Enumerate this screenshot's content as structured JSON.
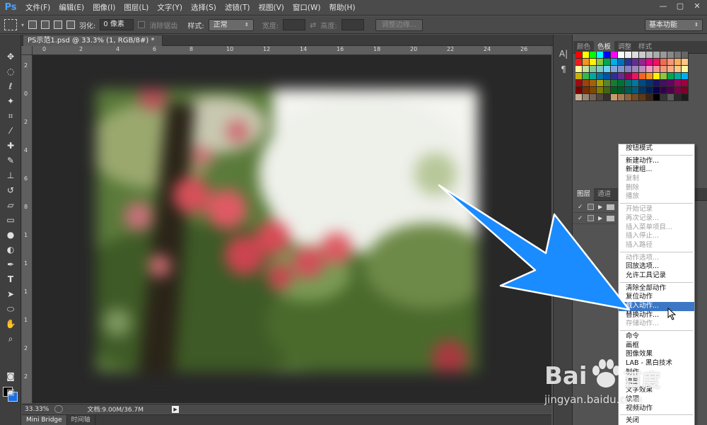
{
  "app": {
    "logo": "Ps"
  },
  "menubar": {
    "items": [
      "文件(F)",
      "编辑(E)",
      "图像(I)",
      "图层(L)",
      "文字(Y)",
      "选择(S)",
      "滤镜(T)",
      "视图(V)",
      "窗口(W)",
      "帮助(H)"
    ],
    "window_controls": [
      "—",
      "▢",
      "✕"
    ]
  },
  "options": {
    "feather_label": "羽化:",
    "feather_value": "0 像素",
    "antialias_label": "消除锯齿",
    "style_label": "样式:",
    "style_value": "正常",
    "width_label": "宽度:",
    "height_label": "高度:",
    "refine_edge": "调整边缘...",
    "workspace": "基本功能"
  },
  "document": {
    "tab_title": "PS示范1.psd @ 33.3% (1, RGB/8#) *",
    "close": "×",
    "ruler_top": [
      "0",
      "2",
      "4",
      "6",
      "8",
      "10",
      "12",
      "14",
      "16",
      "18",
      "20",
      "22",
      "24",
      "26"
    ],
    "ruler_left": [
      "2",
      "0",
      "2",
      "4",
      "6",
      "8",
      "1",
      "1",
      "1",
      "1",
      "2",
      "2"
    ]
  },
  "status": {
    "zoom": "33.33%",
    "doc_info": "文档:9.00M/36.7M"
  },
  "bottom_tabs": [
    "Mini Bridge",
    "时间轴"
  ],
  "panels": {
    "top_tabs": [
      "颜色",
      "色板",
      "调整",
      "样式"
    ],
    "top_active": 1,
    "mid_tabs": [
      "图层",
      "通道"
    ],
    "swatch_colors": [
      [
        "#ff0000",
        "#ffff00",
        "#00ff00",
        "#00ffff",
        "#0000ff",
        "#ff00ff",
        "#ffffff",
        "#eeeeee",
        "#dddddd",
        "#cccccc",
        "#bbbbbb",
        "#aaaaaa",
        "#999999",
        "#888888",
        "#777777",
        "#666666"
      ],
      [
        "#ed1c24",
        "#f7941d",
        "#fff200",
        "#8dc63f",
        "#00a651",
        "#00aeef",
        "#0072bc",
        "#2e3192",
        "#662d91",
        "#92278f",
        "#ec008c",
        "#ed145b",
        "#f26c4f",
        "#f69679",
        "#fbaf5d",
        "#fdc689"
      ],
      [
        "#fff799",
        "#c4df9b",
        "#82ca9c",
        "#7accc8",
        "#6dcff6",
        "#7da7d9",
        "#8393ca",
        "#8781bd",
        "#a186be",
        "#bd8cbf",
        "#f49ac1",
        "#f5989d",
        "#f7977a",
        "#fbad82",
        "#fdc68a",
        "#fff79a"
      ],
      [
        "#c6b300",
        "#39b54a",
        "#00a99d",
        "#0076a3",
        "#0054a6",
        "#2e3192",
        "#662d91",
        "#9e005d",
        "#ed145b",
        "#f26522",
        "#f7941d",
        "#fff200",
        "#8dc63f",
        "#00a651",
        "#00a99d",
        "#00aeef"
      ],
      [
        "#9e0b0f",
        "#a0410d",
        "#a36209",
        "#aba000",
        "#598527",
        "#197b30",
        "#007236",
        "#00746b",
        "#0076a3",
        "#004a80",
        "#003471",
        "#1b1464",
        "#440e62",
        "#630460",
        "#9e005d",
        "#9e0039"
      ],
      [
        "#790000",
        "#7b2e00",
        "#7d4900",
        "#827b00",
        "#406618",
        "#005e20",
        "#005826",
        "#005952",
        "#005b7f",
        "#003663",
        "#002157",
        "#0d004c",
        "#32004b",
        "#4b0049",
        "#7b0046",
        "#7a0026"
      ],
      [
        "#c7b299",
        "#998675",
        "#736357",
        "#534741",
        "#37302a",
        "#c69c6d",
        "#a67c52",
        "#8c6239",
        "#754c24",
        "#603913",
        "#3c2415",
        "#000000",
        "#363636",
        "#5a5a5a",
        "#2a2a2a",
        "#1c1c1c"
      ]
    ]
  },
  "layers": [
    {
      "check": "✓"
    },
    {
      "check": "✓"
    }
  ],
  "context_menu": {
    "groups": [
      [
        {
          "label": "按钮模式",
          "disabled": false
        }
      ],
      [
        {
          "label": "新建动作...",
          "disabled": false
        },
        {
          "label": "新建组...",
          "disabled": false
        },
        {
          "label": "复制",
          "disabled": true
        },
        {
          "label": "删除",
          "disabled": true
        },
        {
          "label": "播放",
          "disabled": true
        }
      ],
      [
        {
          "label": "开始记录",
          "disabled": true
        },
        {
          "label": "再次记录...",
          "disabled": true
        },
        {
          "label": "插入菜单项目...",
          "disabled": true
        },
        {
          "label": "插入停止...",
          "disabled": true
        },
        {
          "label": "插入路径",
          "disabled": true
        }
      ],
      [
        {
          "label": "动作选项...",
          "disabled": true
        },
        {
          "label": "回放选项...",
          "disabled": false
        },
        {
          "label": "允许工具记录",
          "disabled": false
        }
      ],
      [
        {
          "label": "清除全部动作",
          "disabled": false
        },
        {
          "label": "复位动作",
          "disabled": false
        },
        {
          "label": "载入动作...",
          "disabled": false,
          "highlighted": true
        },
        {
          "label": "替换动作...",
          "disabled": false
        },
        {
          "label": "存储动作...",
          "disabled": true
        }
      ],
      [
        {
          "label": "命令",
          "disabled": false
        },
        {
          "label": "画框",
          "disabled": false
        },
        {
          "label": "图像效果",
          "disabled": false
        },
        {
          "label": "LAB - 黑白技术",
          "disabled": false
        },
        {
          "label": "制作",
          "disabled": false
        },
        {
          "label": "流星",
          "disabled": false
        },
        {
          "label": "文字效果",
          "disabled": false
        },
        {
          "label": "纹理",
          "disabled": false
        },
        {
          "label": "视频动作",
          "disabled": false
        }
      ],
      [
        {
          "label": "关闭",
          "disabled": false
        }
      ]
    ]
  },
  "watermark": {
    "brand": "Bai",
    "brand2": "百度",
    "subtitle": "jingyan.baidu.com"
  },
  "colors": {
    "arrow": "#1a8cff",
    "highlight": "#3b77c5",
    "ps_blue": "#4aa3ff"
  }
}
